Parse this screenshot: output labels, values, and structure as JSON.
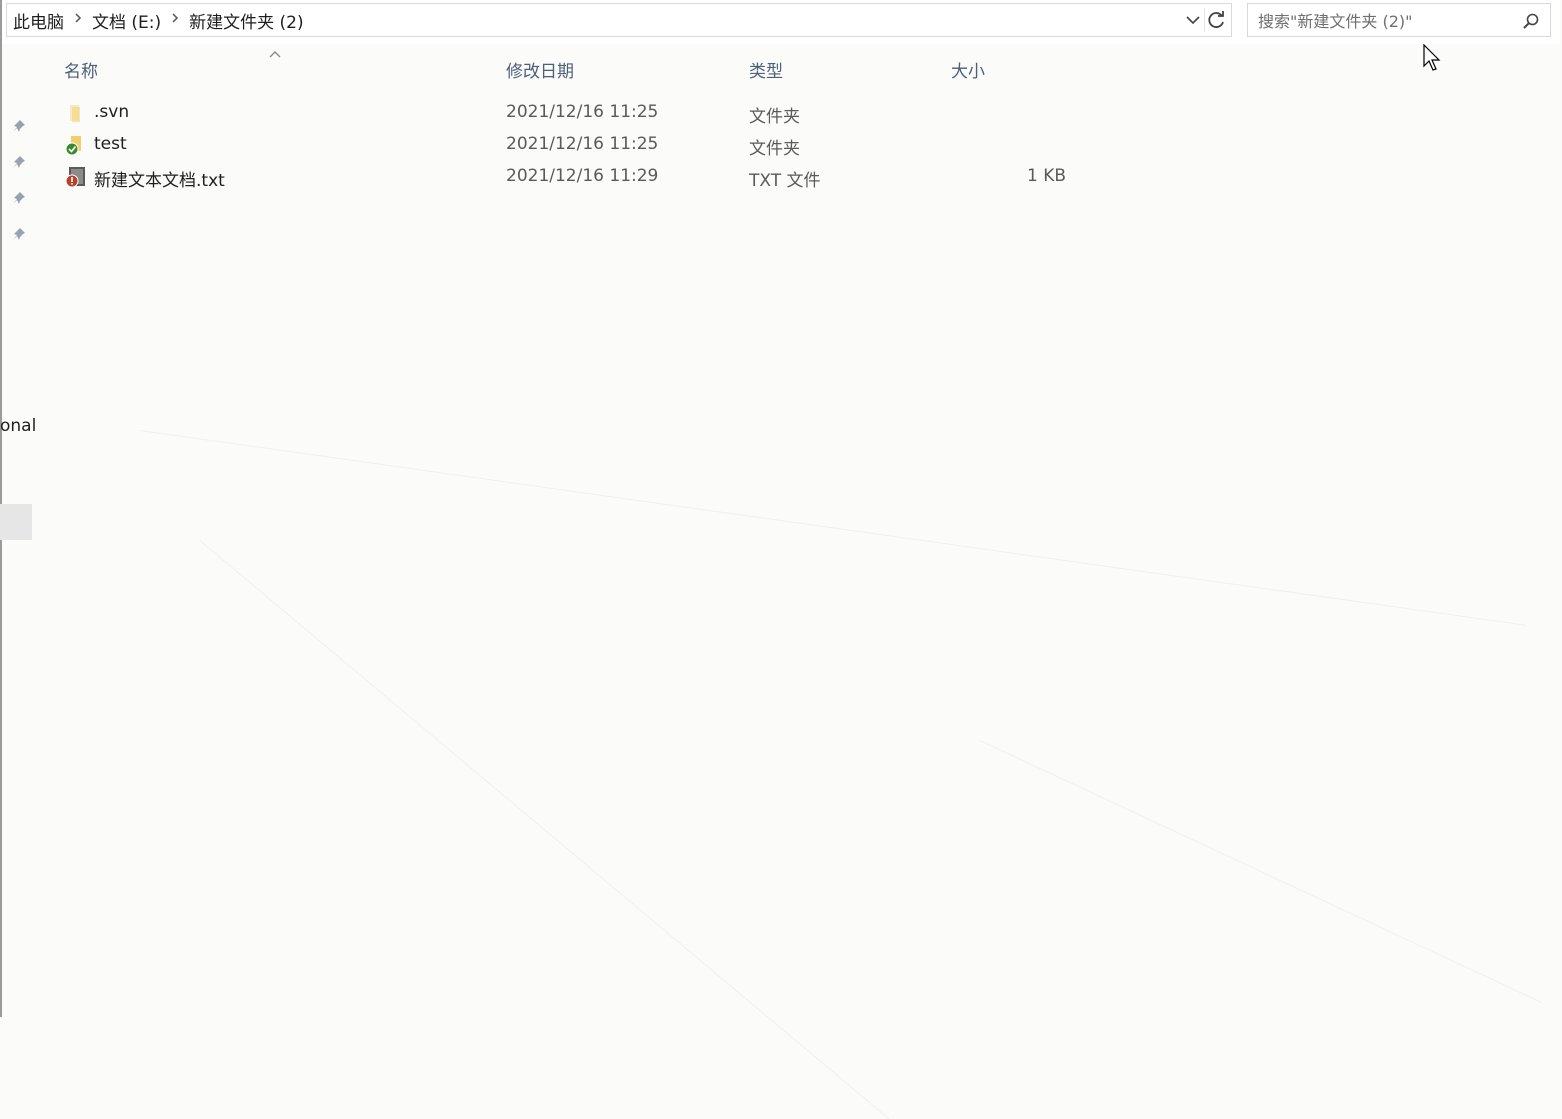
{
  "breadcrumb": {
    "items": [
      "此电脑",
      "文档 (E:)",
      "新建文件夹 (2)"
    ]
  },
  "search": {
    "placeholder": "搜索\"新建文件夹 (2)\""
  },
  "columns": {
    "name": "名称",
    "modified": "修改日期",
    "type": "类型",
    "size": "大小"
  },
  "files": [
    {
      "name": ".svn",
      "modified": "2021/12/16 11:25",
      "type": "文件夹",
      "size": "",
      "icon": "folder-icon"
    },
    {
      "name": "test",
      "modified": "2021/12/16 11:25",
      "type": "文件夹",
      "size": "",
      "icon": "svn-normal-folder-icon"
    },
    {
      "name": "新建文本文档.txt",
      "modified": "2021/12/16 11:29",
      "type": "TXT 文件",
      "size": "1 KB",
      "icon": "svn-modified-file-icon"
    }
  ],
  "sidebar": {
    "partial_label": "onal"
  },
  "colors": {
    "header_text": "#4c607a",
    "svn_ok": "#3a8a2f",
    "svn_modified": "#b8412a",
    "folder": "#f2cf6e"
  }
}
